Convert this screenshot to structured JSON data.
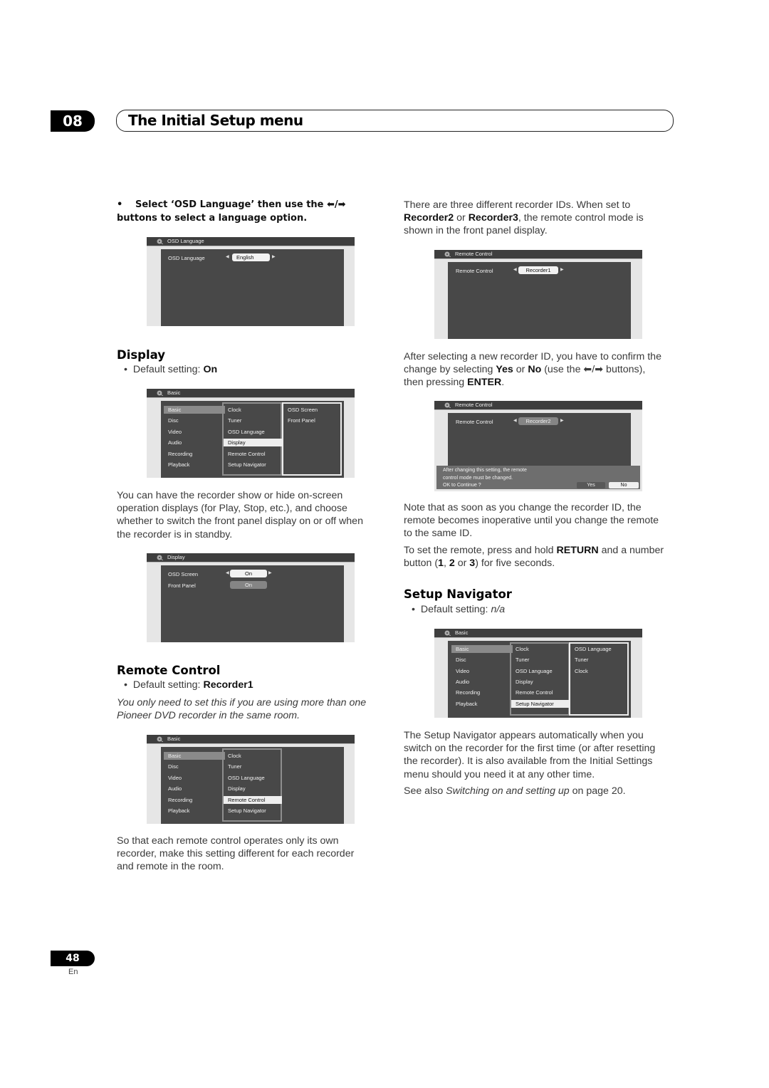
{
  "header": {
    "chapter_number": "08",
    "chapter_title": "The Initial Setup menu"
  },
  "left": {
    "instruction_line1": "Select ‘OSD Language’ then use the ⬅/➡",
    "instruction_line2": "buttons to select a language option.",
    "osd_language_screen": {
      "bar_title": "OSD Language",
      "row_label": "OSD Language",
      "value": "English"
    },
    "display": {
      "heading": "Display",
      "default_prefix": "Default setting: ",
      "default_value": "On",
      "menu_screen": {
        "bar_title": "Basic",
        "col1": [
          "Basic",
          "Disc",
          "Video",
          "Audio",
          "Recording",
          "Playback"
        ],
        "col2": [
          "Clock",
          "Tuner",
          "OSD Language",
          "Display",
          "Remote Control",
          "Setup Navigator"
        ],
        "col3": [
          "OSD Screen",
          "Front Panel"
        ],
        "selected_col1": "Basic",
        "selected_col2": "Display"
      },
      "description": [
        "You can have the recorder show or hide on-screen",
        "operation displays (for Play, Stop, etc.), and choose",
        "whether to switch the front panel display on or off when",
        "the recorder is in standby."
      ],
      "display_screen": {
        "bar_title": "Display",
        "rows": [
          {
            "label": "OSD Screen",
            "value": "On"
          },
          {
            "label": "Front Panel",
            "value": "On"
          }
        ]
      }
    },
    "remote_control": {
      "heading": "Remote Control",
      "default_prefix": "Default setting: ",
      "default_value": "Recorder1",
      "note_line1": "You only need to set this if you are using more than one",
      "note_line2": "Pioneer DVD recorder in the same room.",
      "menu_screen": {
        "bar_title": "Basic",
        "col1": [
          "Basic",
          "Disc",
          "Video",
          "Audio",
          "Recording",
          "Playback"
        ],
        "col2": [
          "Clock",
          "Tuner",
          "OSD Language",
          "Display",
          "Remote Control",
          "Setup Navigator"
        ],
        "selected_col1": "Basic",
        "selected_col2": "Remote Control"
      },
      "description": [
        "So that each remote control operates only its own",
        "recorder, make this setting different for each recorder",
        "and remote in the room."
      ]
    }
  },
  "right": {
    "intro": {
      "line1": "There are three different recorder IDs. When set to",
      "bold1": "Recorder2",
      "or": " or ",
      "bold2": "Recorder3",
      "line2_rest": ", the remote control mode is",
      "line3": "shown in the front panel display."
    },
    "remote_screen_1": {
      "bar_title": "Remote Control",
      "row_label": "Remote Control",
      "value": "Recorder1"
    },
    "confirm_text": {
      "line1": "After selecting a new recorder ID, you have to confirm the",
      "pre_yes": "change by selecting ",
      "yes": "Yes",
      "or": " or ",
      "no": "No",
      "post": " (use the ⬅/➡ buttons),",
      "line3_pre": "then pressing ",
      "enter": "ENTER",
      "line3_post": "."
    },
    "remote_screen_2": {
      "bar_title": "Remote Control",
      "row_label": "Remote Control",
      "value": "Recorder2",
      "dialog_line1": "After changing this setting, the remote",
      "dialog_line2": "control mode must be changed.",
      "dialog_line3": "OK to Continue ?",
      "yes_label": "Yes",
      "no_label": "No"
    },
    "note": [
      "Note that as soon as you change the recorder ID, the",
      "remote becomes inoperative until you change the remote",
      "to the same ID."
    ],
    "set_remote": {
      "pre": "To set the remote, press and hold ",
      "return": "RETURN",
      "post": " and a number",
      "l2_pre": "button (",
      "n1": "1",
      "c": ", ",
      "n2": "2",
      "or": " or ",
      "n3": "3",
      "l2_post": ") for five seconds."
    },
    "setup_navigator": {
      "heading": "Setup Navigator",
      "default_prefix": "Default setting: ",
      "default_value": "n/a",
      "menu_screen": {
        "bar_title": "Basic",
        "col1": [
          "Basic",
          "Disc",
          "Video",
          "Audio",
          "Recording",
          "Playback"
        ],
        "col2": [
          "Clock",
          "Tuner",
          "OSD Language",
          "Display",
          "Remote Control",
          "Setup Navigator"
        ],
        "col3": [
          "OSD Language",
          "Tuner",
          "Clock"
        ],
        "selected_col1": "Basic",
        "selected_col2": "Setup Navigator"
      },
      "description": [
        "The Setup Navigator appears automatically when you",
        "switch on the recorder for the first time (or after resetting",
        "the recorder). It is also available from the Initial Settings",
        "menu should you need it at any other time."
      ],
      "see_also_pre": "See also ",
      "see_also_link": "Switching on and setting up",
      "see_also_post": " on page 20."
    }
  },
  "footer": {
    "page_number": "48",
    "language": "En"
  }
}
